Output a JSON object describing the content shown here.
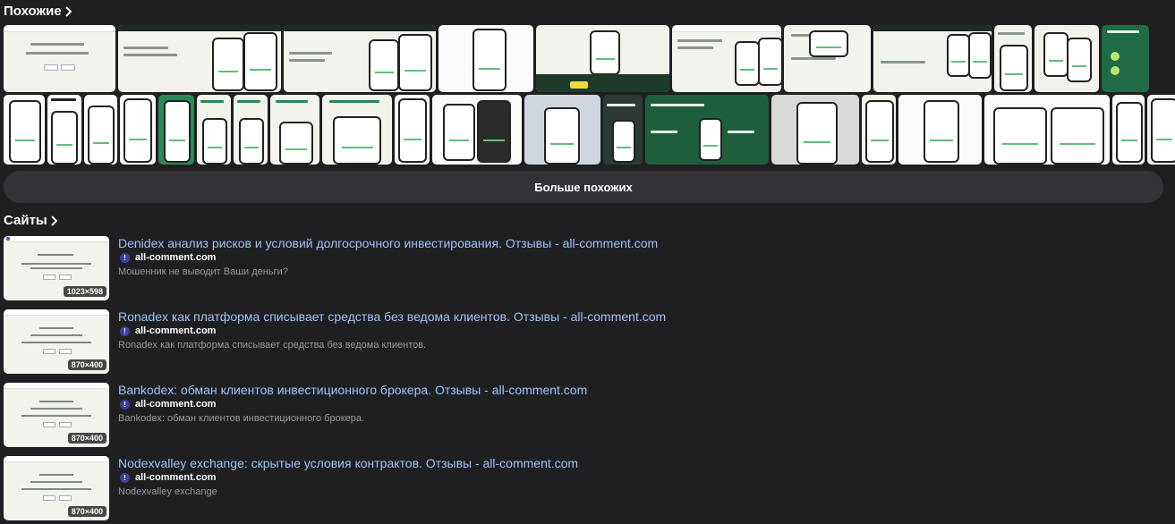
{
  "similar": {
    "title": "Похожие",
    "more_button": "Больше похожих"
  },
  "sites": {
    "title": "Сайты",
    "results": [
      {
        "title": "Denidex анализ рисков и условий долгосрочного инвестирования. Отзывы - all-comment.com",
        "domain": "all-comment.com",
        "description": "Мошенник не выводит Ваши деньги?",
        "size": "1023×598"
      },
      {
        "title": "Ronadex как платформа списывает средства без ведома клиентов. Отзывы - all-comment.com",
        "domain": "all-comment.com",
        "description": "Ronadex как платформа списывает средства без ведома клиентов.",
        "size": "870×400"
      },
      {
        "title": "Bankodex: обман клиентов инвестиционного брокера. Отзывы - all-comment.com",
        "domain": "all-comment.com",
        "description": "Bankodex: обман клиентов инвестиционного брокера.",
        "size": "870×400"
      },
      {
        "title": "Nodexvalley exchange: скрытые условия контрактов. Отзывы - all-comment.com",
        "domain": "all-comment.com",
        "description": "Nodexvalley exchange",
        "size": "870×400"
      }
    ]
  },
  "colors": {
    "background": "#1f1f22",
    "link": "#9ec3f5",
    "button_bg": "#333337",
    "favicon": "#3b3f9e"
  },
  "icons": {
    "section_arrow": "chevron-right-icon",
    "favicon": "info-icon"
  }
}
